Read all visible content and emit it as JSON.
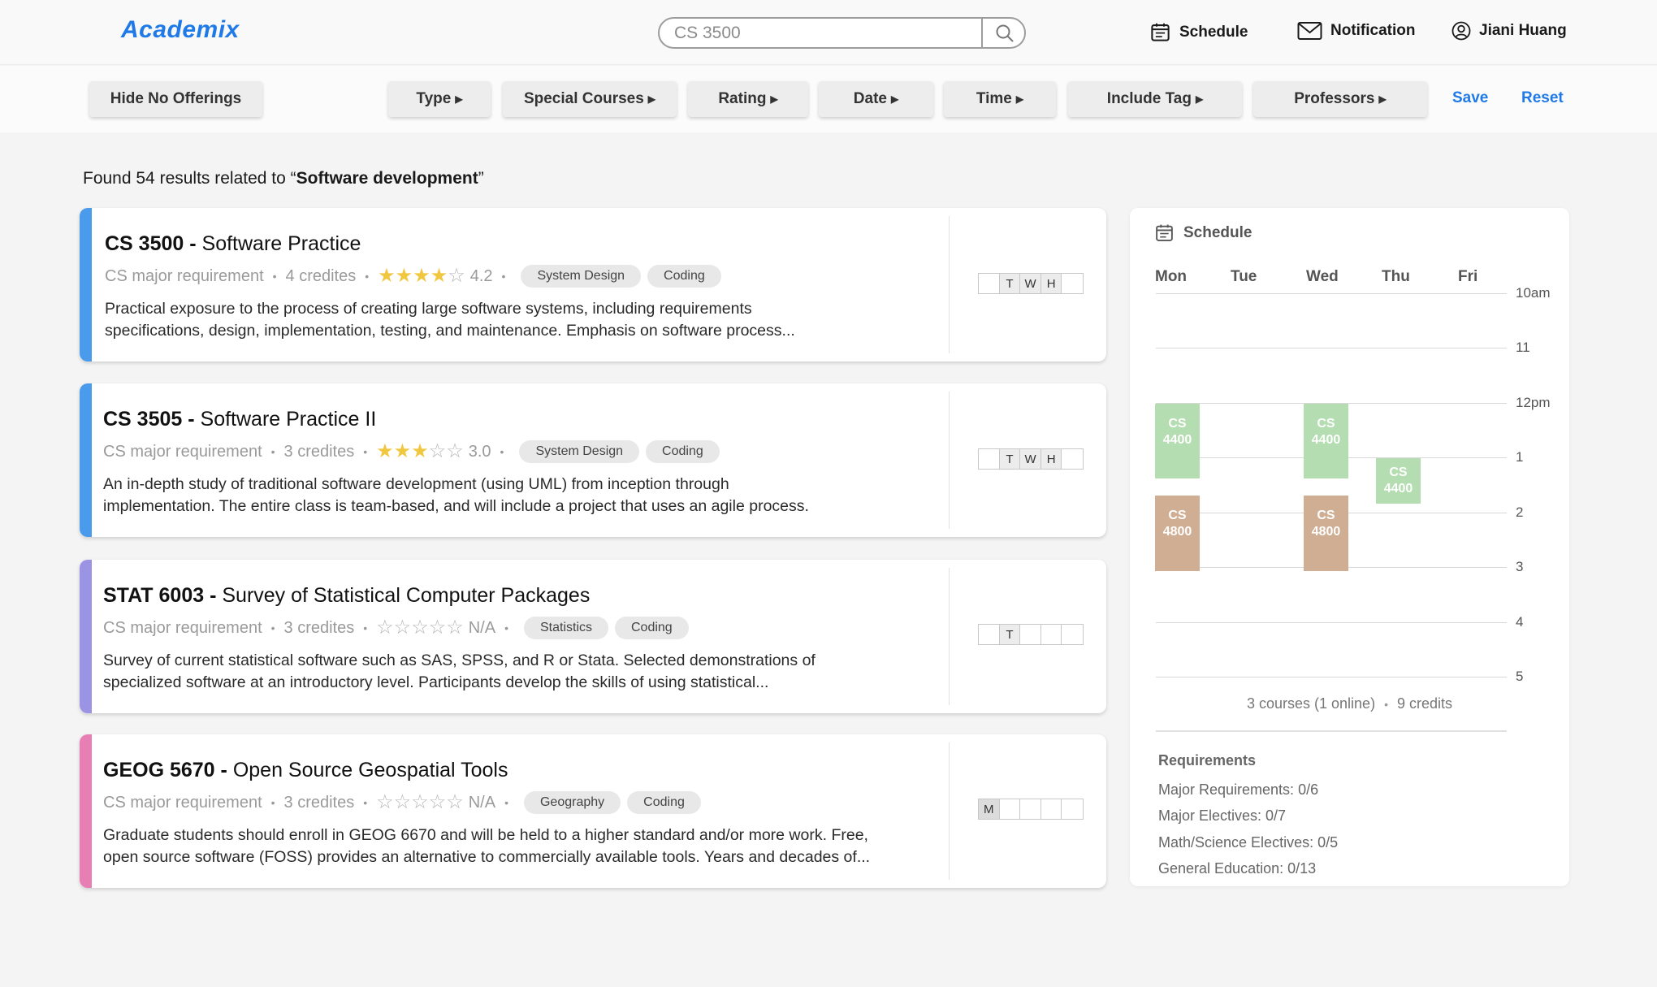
{
  "header": {
    "logo": "Academix",
    "search_value": "CS 3500",
    "nav": {
      "schedule": "Schedule",
      "notification": "Notification",
      "user": "Jiani Huang"
    }
  },
  "filters": {
    "hide": "Hide No Offerings",
    "type": "Type",
    "special": "Special Courses",
    "rating": "Rating",
    "date": "Date",
    "time": "Time",
    "include_tag": "Include Tag",
    "professors": "Professors",
    "save": "Save",
    "reset": "Reset"
  },
  "results": {
    "prefix": "Found 54 results related to “",
    "query": "Software development",
    "suffix": "”"
  },
  "courses": [
    {
      "code": "CS 3500 -",
      "name": "Software Practice",
      "requirement": "CS major requirement",
      "credits": "4 credites",
      "rating_label": "4.2",
      "stars_full": 4,
      "tags": [
        "System Design",
        "Coding"
      ],
      "desc1": "Practical exposure to the process of creating large software systems, including requirements",
      "desc2": "specifications, design, implementation, testing, and maintenance. Emphasis on software process...",
      "days": [
        "",
        "T",
        "W",
        "H",
        ""
      ],
      "accent": "#4a9bec"
    },
    {
      "code": "CS 3505 -",
      "name": "Software Practice II",
      "requirement": "CS major requirement",
      "credits": "3 credites",
      "rating_label": "3.0",
      "stars_full": 3,
      "tags": [
        "System Design",
        "Coding"
      ],
      "desc1": "An in-depth study of traditional software development (using UML) from inception through",
      "desc2": "implementation. The entire class is team-based, and will include a project that uses an agile process.",
      "days": [
        "",
        "T",
        "W",
        "H",
        ""
      ],
      "accent": "#4a9bec"
    },
    {
      "code": "STAT 6003 -",
      "name": "Survey of Statistical Computer Packages",
      "requirement": "CS major requirement",
      "credits": "3 credites",
      "rating_label": "N/A",
      "stars_full": 0,
      "tags": [
        "Statistics",
        "Coding"
      ],
      "desc1": "Survey of current statistical software such as SAS, SPSS, and R or Stata. Selected demonstrations of",
      "desc2": "specialized software at an introductory level. Participants develop the skills of using statistical...",
      "days": [
        "",
        "T",
        "",
        "",
        ""
      ],
      "accent": "#9b94e4"
    },
    {
      "code": "GEOG 5670 -",
      "name": "Open Source Geospatial Tools",
      "requirement": "CS major requirement",
      "credits": "3 credites",
      "rating_label": "N/A",
      "stars_full": 0,
      "tags": [
        "Geography",
        "Coding"
      ],
      "desc1": "Graduate students should enroll in GEOG 6670 and will be held to a higher standard and/or more work. Free,",
      "desc2": "open source software (FOSS) provides an alternative to commercially available tools. Years and decades of...",
      "days": [
        "M",
        "",
        "",
        "",
        ""
      ],
      "accent": "#e77fb5"
    }
  ],
  "schedule": {
    "title": "Schedule",
    "days": [
      "Mon",
      "Tue",
      "Wed",
      "Thu",
      "Fri"
    ],
    "hours": [
      "10am",
      "11",
      "12pm",
      "1",
      "2",
      "3",
      "4",
      "5"
    ],
    "blocks": [
      {
        "label": "CS 4400",
        "day": "Mon",
        "start": "12pm",
        "end": "1:20",
        "color": "green"
      },
      {
        "label": "CS 4400",
        "day": "Wed",
        "start": "12pm",
        "end": "1:20",
        "color": "green"
      },
      {
        "label": "CS 4400",
        "day": "Thu",
        "start": "1",
        "end": "1:50",
        "color": "green"
      },
      {
        "label": "CS 4800",
        "day": "Mon",
        "start": "1:40",
        "end": "3",
        "color": "tan"
      },
      {
        "label": "CS 4800",
        "day": "Wed",
        "start": "1:40",
        "end": "3",
        "color": "tan"
      }
    ],
    "summary": "3 courses (1 online)",
    "credits": "9 credits",
    "requirements_title": "Requirements",
    "requirements": [
      "Major Requirements: 0/6",
      "Major Electives: 0/7",
      "Math/Science Electives: 0/5",
      "General Education: 0/13"
    ]
  },
  "colors": {
    "accent_blue": "#1f7ae8",
    "green_block": "#b4deb1",
    "tan_block": "#cfae93",
    "star": "#f2c740"
  }
}
